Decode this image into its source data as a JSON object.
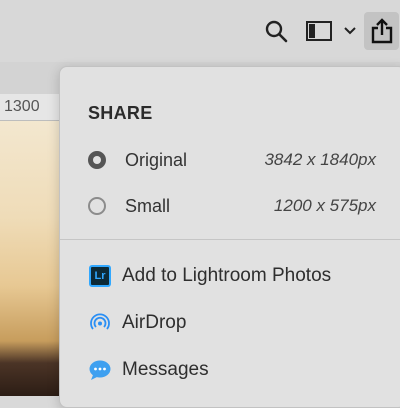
{
  "toolbar": {
    "icons": [
      "search-icon",
      "panel-icon",
      "chevron-down-icon",
      "share-icon"
    ]
  },
  "ruler": {
    "label": "1300"
  },
  "share_popover": {
    "title": "SHARE",
    "options": [
      {
        "label": "Original",
        "size": "3842 x 1840px",
        "selected": true
      },
      {
        "label": "Small",
        "size": "1200 x 575px",
        "selected": false
      }
    ],
    "actions": [
      {
        "label": "Add to Lightroom Photos",
        "icon": "lightroom-icon"
      },
      {
        "label": "AirDrop",
        "icon": "airdrop-icon"
      },
      {
        "label": "Messages",
        "icon": "messages-icon"
      }
    ]
  },
  "colors": {
    "accent_lightroom": "#31a8ff",
    "airdrop": "#2a8ff5",
    "messages": "#3ea0f0"
  }
}
